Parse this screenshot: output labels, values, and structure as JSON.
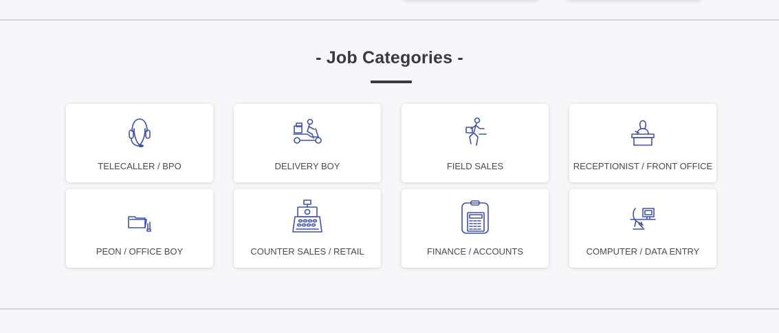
{
  "section": {
    "title": "- Job Categories -"
  },
  "categories": [
    {
      "label": "TELECALLER / BPO",
      "icon": "headset-icon"
    },
    {
      "label": "DELIVERY BOY",
      "icon": "delivery-scooter-icon"
    },
    {
      "label": "FIELD SALES",
      "icon": "running-salesman-icon"
    },
    {
      "label": "RECEPTIONIST / FRONT OFFICE",
      "icon": "receptionist-desk-icon"
    },
    {
      "label": "PEON / OFFICE BOY",
      "icon": "folder-icon"
    },
    {
      "label": "COUNTER SALES / RETAIL",
      "icon": "cash-register-icon"
    },
    {
      "label": "FINANCE / ACCOUNTS",
      "icon": "calculator-icon"
    },
    {
      "label": "COMPUTER / DATA ENTRY",
      "icon": "computer-desk-icon"
    }
  ],
  "colors": {
    "icon": "#3d4fb0",
    "title": "#3a3a3e",
    "background": "#f7f7f9",
    "card": "#ffffff"
  }
}
